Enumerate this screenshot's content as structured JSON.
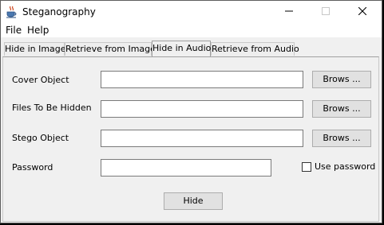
{
  "window": {
    "title": "Steganography"
  },
  "menu": [
    "File",
    "Help"
  ],
  "tabs": [
    {
      "label": "Hide in Image",
      "active": false
    },
    {
      "label": "Retrieve from Image",
      "active": false
    },
    {
      "label": "Hide in Audio",
      "active": true
    },
    {
      "label": "Retrieve from Audio",
      "active": false
    }
  ],
  "form": {
    "cover_label": "Cover Object",
    "cover_value": "",
    "cover_browse": "Brows ...",
    "hidden_label": "Files To Be Hidden",
    "hidden_value": "",
    "hidden_browse": "Brows ...",
    "stego_label": "Stego Object",
    "stego_value": "",
    "stego_browse": "Brows ...",
    "password_label": "Password",
    "password_value": "",
    "use_password_label": "Use password",
    "use_password_checked": false,
    "hide_button": "Hide"
  },
  "icons": {
    "app": "java-coffee-cup-icon",
    "minimize": "minimize-icon",
    "maximize": "maximize-icon",
    "close": "close-icon"
  }
}
